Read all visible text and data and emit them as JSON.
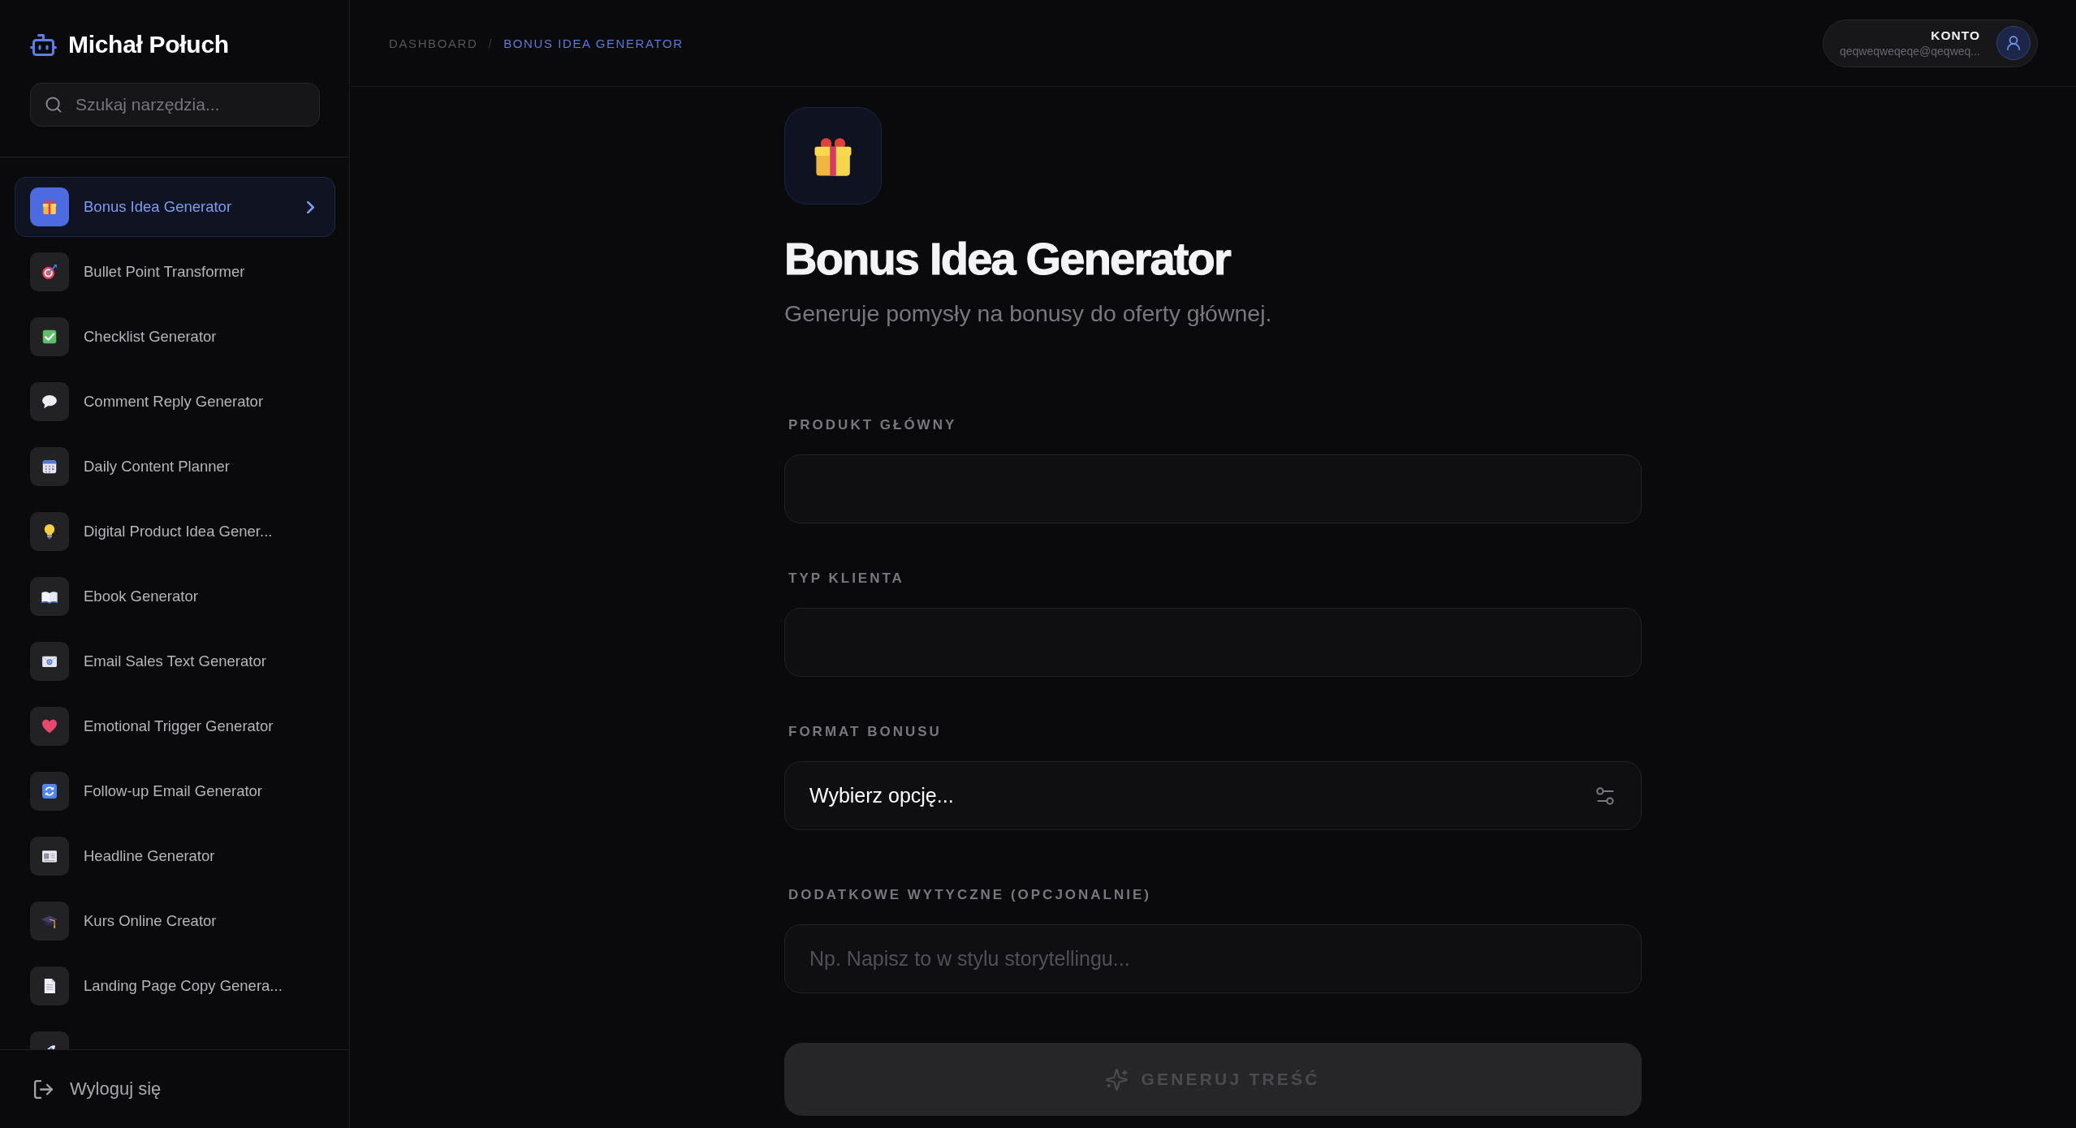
{
  "sidebar": {
    "brand": "Michał Połuch",
    "search": {
      "placeholder": "Szukaj narzędzia..."
    },
    "items": [
      {
        "label": "Bonus Idea Generator",
        "selected": true
      },
      {
        "label": "Bullet Point Transformer",
        "selected": false
      },
      {
        "label": "Checklist Generator",
        "selected": false
      },
      {
        "label": "Comment Reply Generator",
        "selected": false
      },
      {
        "label": "Daily Content Planner",
        "selected": false
      },
      {
        "label": "Digital Product Idea Gener...",
        "selected": false
      },
      {
        "label": "Ebook Generator",
        "selected": false
      },
      {
        "label": "Email Sales Text Generator",
        "selected": false
      },
      {
        "label": "Emotional Trigger Generator",
        "selected": false
      },
      {
        "label": "Follow-up Email Generator",
        "selected": false
      },
      {
        "label": "Headline Generator",
        "selected": false
      },
      {
        "label": "Kurs Online Creator",
        "selected": false
      },
      {
        "label": "Landing Page Copy Genera...",
        "selected": false
      },
      {
        "selected": false
      }
    ],
    "logout": "Wyloguj się"
  },
  "breadcrumb": {
    "separator": "/",
    "items": [
      {
        "label": "DASHBOARD",
        "current": false
      },
      {
        "label": "BONUS IDEA GENERATOR",
        "current": true
      }
    ]
  },
  "account": {
    "label": "KONTO",
    "email": "qeqweqweqeqe@qeqweq..."
  },
  "page": {
    "title": "Bonus Idea Generator",
    "subtitle": "Generuje pomysły na bonusy do oferty głównej."
  },
  "form": {
    "fields": [
      {
        "kind": "text",
        "label": "PRODUKT GŁÓWNY"
      },
      {
        "kind": "text",
        "label": "TYP KLIENTA"
      },
      {
        "kind": "select",
        "label": "FORMAT BONUSU",
        "value": "Wybierz opcję..."
      },
      {
        "kind": "text",
        "label": "DODATKOWE WYTYCZNE (OPCJONALNIE)",
        "placeholder": "Np. Napisz to w stylu storytellingu..."
      }
    ],
    "submit": {
      "label": "GENERUJ TREŚĆ",
      "disabled": true
    }
  }
}
